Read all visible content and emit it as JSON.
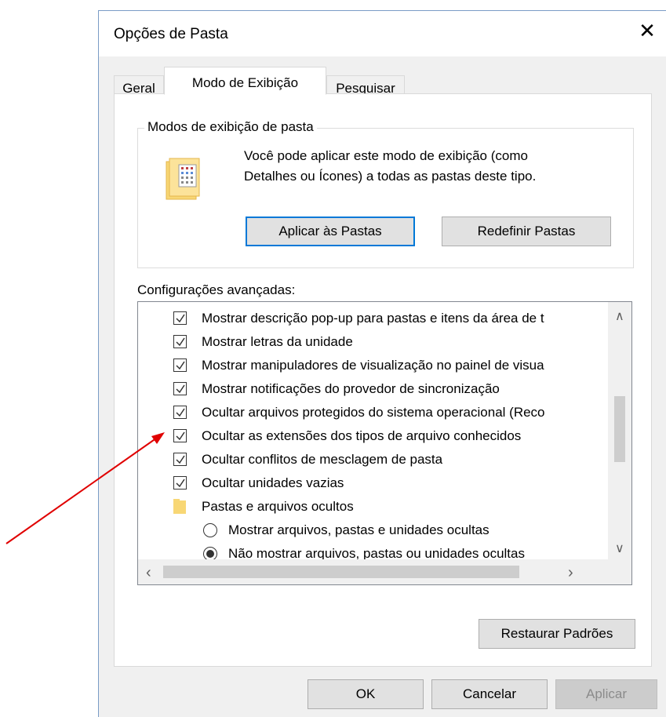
{
  "dialog": {
    "title": "Opções de Pasta",
    "close_glyph": "✕"
  },
  "tabs": [
    {
      "label": "Geral"
    },
    {
      "label": "Modo de Exibição"
    },
    {
      "label": "Pesquisar"
    }
  ],
  "folder_views": {
    "legend": "Modos de exibição de pasta",
    "description_line1": "Você pode aplicar este modo de exibição (como",
    "description_line2": "Detalhes ou Ícones) a todas as pastas deste tipo.",
    "apply_button": "Aplicar às Pastas",
    "reset_button": "Redefinir Pastas"
  },
  "advanced": {
    "label": "Configurações avançadas:",
    "items": [
      {
        "type": "checkbox",
        "checked": true,
        "label": "Mostrar descrição pop-up para pastas e itens da área de t"
      },
      {
        "type": "checkbox",
        "checked": true,
        "label": "Mostrar letras da unidade"
      },
      {
        "type": "checkbox",
        "checked": true,
        "label": "Mostrar manipuladores de visualização no painel de visua"
      },
      {
        "type": "checkbox",
        "checked": true,
        "label": "Mostrar notificações do provedor de sincronização"
      },
      {
        "type": "checkbox",
        "checked": true,
        "label": "Ocultar arquivos protegidos do sistema operacional (Reco"
      },
      {
        "type": "checkbox",
        "checked": true,
        "label": "Ocultar as extensões dos tipos de arquivo conhecidos"
      },
      {
        "type": "checkbox",
        "checked": true,
        "label": "Ocultar conflitos de mesclagem de pasta"
      },
      {
        "type": "checkbox",
        "checked": true,
        "label": "Ocultar unidades vazias"
      },
      {
        "type": "folder",
        "label": "Pastas e arquivos ocultos"
      },
      {
        "type": "radio",
        "selected": false,
        "label": "Mostrar arquivos, pastas e unidades ocultas"
      },
      {
        "type": "radio",
        "selected": true,
        "label": "Não mostrar arquivos, pastas ou unidades ocultas"
      }
    ],
    "restore_button": "Restaurar Padrões"
  },
  "footer": {
    "ok": "OK",
    "cancel": "Cancelar",
    "apply": "Aplicar"
  },
  "colors": {
    "accent": "#0078d7",
    "annotation_arrow": "#e00000",
    "folder": "#f8d775"
  }
}
